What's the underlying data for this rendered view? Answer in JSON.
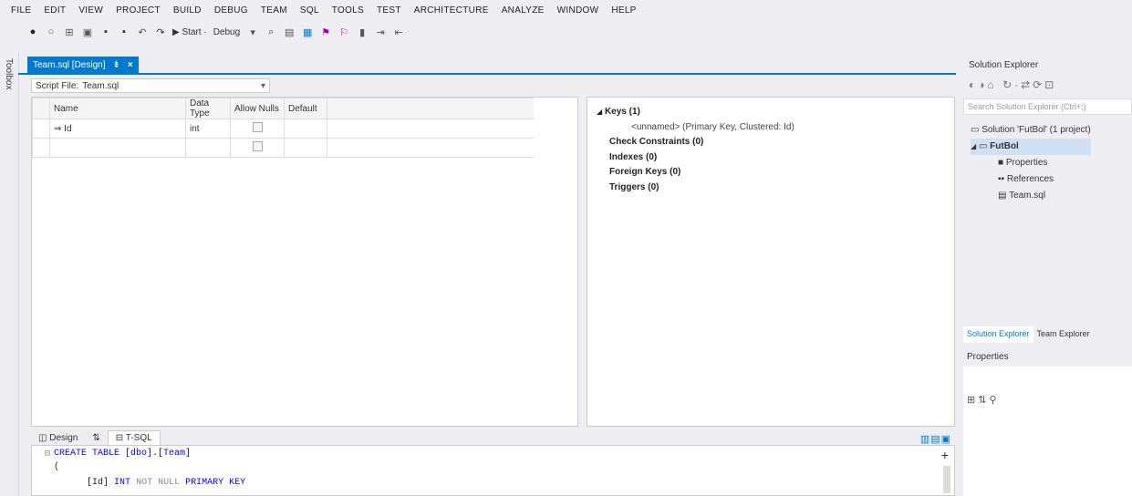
{
  "menu": [
    "FILE",
    "EDIT",
    "VIEW",
    "PROJECT",
    "BUILD",
    "DEBUG",
    "TEAM",
    "SQL",
    "TOOLS",
    "TEST",
    "ARCHITECTURE",
    "ANALYZE",
    "WINDOW",
    "HELP"
  ],
  "toolbar": {
    "start_label": "▶ Start ·",
    "config_label": "Debug"
  },
  "toolbox_label": "Toolbox",
  "doc_tab": {
    "title": "Team.sql [Design]",
    "pin": "⇟",
    "close": "×"
  },
  "script_file": {
    "label": "Script File:",
    "value": "Team.sql"
  },
  "grid": {
    "headers": [
      "Name",
      "Data Type",
      "Allow Nulls",
      "Default"
    ],
    "rows": [
      {
        "marker": "⇒",
        "name": "Id",
        "type": "int",
        "default": ""
      },
      {
        "marker": "",
        "name": "",
        "type": "",
        "default": ""
      }
    ]
  },
  "props": {
    "keys": "Keys (1)",
    "key_item": "<unnamed>   (Primary Key, Clustered: Id)",
    "checks": "Check Constraints (0)",
    "indexes": "Indexes (0)",
    "fks": "Foreign Keys (0)",
    "triggers": "Triggers (0)"
  },
  "bottom_tabs": {
    "design": "Design",
    "swap": "⇅",
    "tsql": "T-SQL"
  },
  "sql": {
    "line1": "CREATE TABLE [dbo].[Team]",
    "line2": "(",
    "line3a": "[Id]",
    "line3b": "INT",
    "line3c": "NOT NULL",
    "line3d": "PRIMARY KEY"
  },
  "solution_explorer": {
    "title": "Solution Explorer",
    "search": "Search Solution Explorer (Ctrl+;)",
    "solution": "Solution 'FutBol' (1 project)",
    "project": "FutBol",
    "items": [
      "Properties",
      "References",
      "Team.sql"
    ],
    "tabs": [
      "Solution Explorer",
      "Team Explorer"
    ]
  },
  "properties_title": "Properties"
}
